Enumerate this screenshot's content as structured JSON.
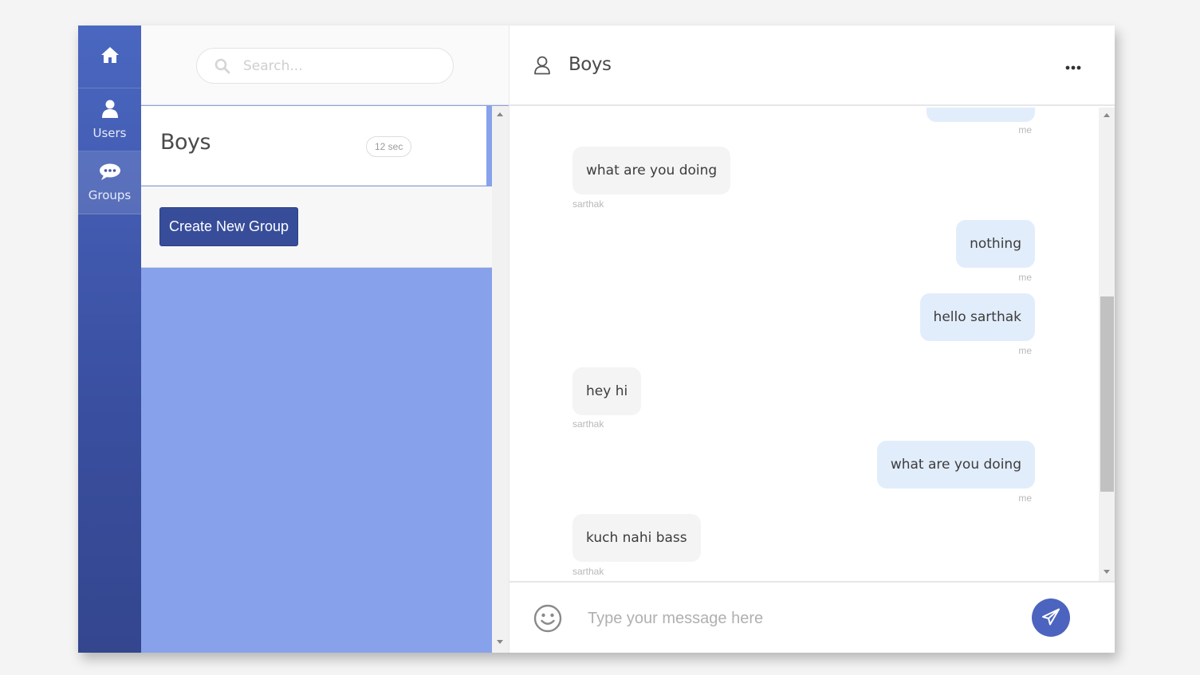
{
  "nav": {
    "items": [
      {
        "label": "",
        "icon": "home-icon"
      },
      {
        "label": "Users",
        "icon": "user-icon"
      },
      {
        "label": "Groups",
        "icon": "chat-bubble-icon"
      }
    ]
  },
  "search": {
    "placeholder": "Search..."
  },
  "groups": [
    {
      "name": "Boys",
      "time": "12 sec"
    }
  ],
  "create_group": {
    "label": "Create New Group"
  },
  "chat": {
    "title": "Boys",
    "messages": [
      {
        "text": "what are you doing",
        "sender": "sarthak",
        "direction": "in"
      },
      {
        "text": "nothing",
        "sender": "me",
        "direction": "out"
      },
      {
        "text": "hello sarthak",
        "sender": "me",
        "direction": "out"
      },
      {
        "text": "hey hi",
        "sender": "sarthak",
        "direction": "in"
      },
      {
        "text": "what are you doing",
        "sender": "me",
        "direction": "out"
      },
      {
        "text": "kuch nahi bass",
        "sender": "sarthak",
        "direction": "in"
      }
    ],
    "partial_top_sender": "me"
  },
  "composer": {
    "placeholder": "Type your message here"
  },
  "colors": {
    "nav_bg": "#3f58ad",
    "primary": "#374d9a",
    "list_bg": "#87a2eb",
    "outgoing_bubble": "#e2edfc",
    "incoming_bubble": "#f4f4f4",
    "send_button": "#4c64bf"
  }
}
